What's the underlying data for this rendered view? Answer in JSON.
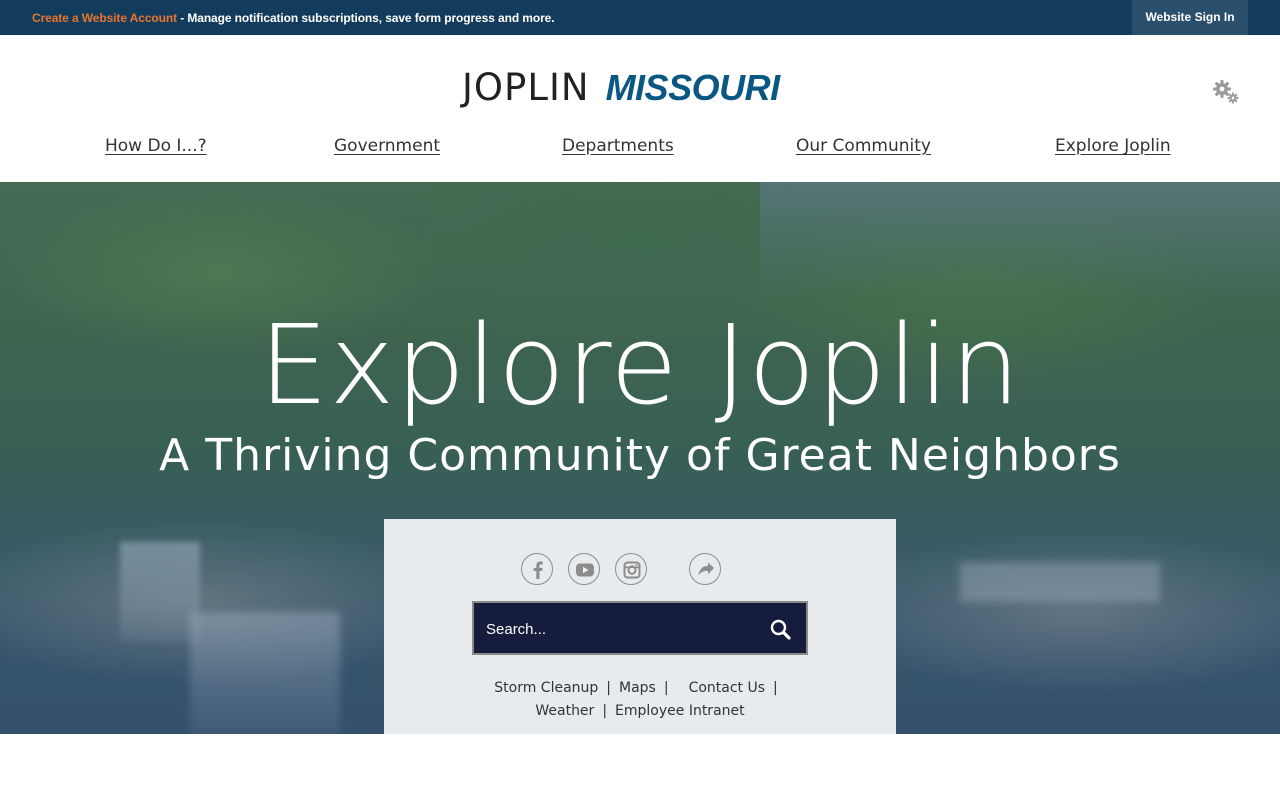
{
  "topbar": {
    "create_account": "Create a Website Account",
    "message": " - Manage notification subscriptions, save form progress and more.",
    "signin_label": "Website Sign In"
  },
  "header": {
    "logo_primary": "JOPLIN",
    "logo_secondary": "MISSOURI",
    "settings_icon": "gear-icon"
  },
  "nav": {
    "items": [
      {
        "label": "How Do I...?"
      },
      {
        "label": "Government"
      },
      {
        "label": "Departments"
      },
      {
        "label": "Our Community"
      },
      {
        "label": "Explore Joplin"
      }
    ]
  },
  "hero": {
    "title": "Explore Joplin",
    "subtitle": "A Thriving Community of Great Neighbors"
  },
  "card": {
    "social": [
      "facebook-icon",
      "youtube-icon",
      "instagram-icon",
      "share-icon"
    ],
    "search": {
      "placeholder": "Search..."
    },
    "quicklinks_row1": [
      "Storm Cleanup",
      "Maps",
      "Contact Us"
    ],
    "quicklinks_row2": [
      "Weather",
      "Employee Intranet"
    ]
  },
  "colors": {
    "topbar": "#133c5c",
    "accent_orange": "#e8742f",
    "logo_blue": "#0b5784",
    "search_bg": "#161c3c"
  }
}
